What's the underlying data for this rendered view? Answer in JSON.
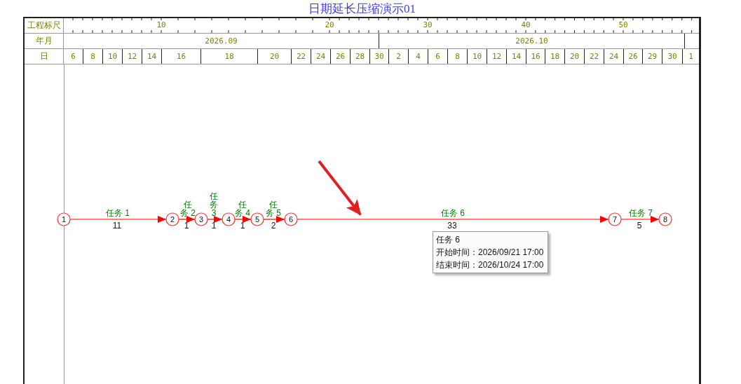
{
  "title": "日期延长压缩演示01",
  "scale_header": {
    "ruler_label": "工程标尺",
    "month_label": "年月",
    "day_label": "日"
  },
  "ruler_ticks": [
    "10",
    "20",
    "30",
    "40",
    "50"
  ],
  "months": [
    "2026.09",
    "2026.10"
  ],
  "days": [
    "6",
    "8",
    "10",
    "12",
    "14",
    "16",
    "18",
    "20",
    "22",
    "24",
    "26",
    "28",
    "30",
    "2",
    "4",
    "6",
    "8",
    "10",
    "12",
    "14",
    "16",
    "18",
    "20",
    "22",
    "24",
    "26",
    "29",
    "30",
    "1"
  ],
  "nodes": [
    "1",
    "2",
    "3",
    "4",
    "5",
    "6",
    "7",
    "8"
  ],
  "tasks": [
    {
      "label": "任务 1",
      "duration": "11"
    },
    {
      "label": "任务 2",
      "duration": "1"
    },
    {
      "label": "任务 3",
      "duration": "1"
    },
    {
      "label": "任务 4",
      "duration": "1"
    },
    {
      "label": "任务 5",
      "duration": "2"
    },
    {
      "label": "任务 6",
      "duration": "33"
    },
    {
      "label": "任务 7",
      "duration": "5"
    }
  ],
  "tooltip": {
    "title": "任务 6",
    "lines": [
      "开始时间：2026/09/21 17:00",
      "结束时间：2026/10/24 17:00"
    ]
  }
}
